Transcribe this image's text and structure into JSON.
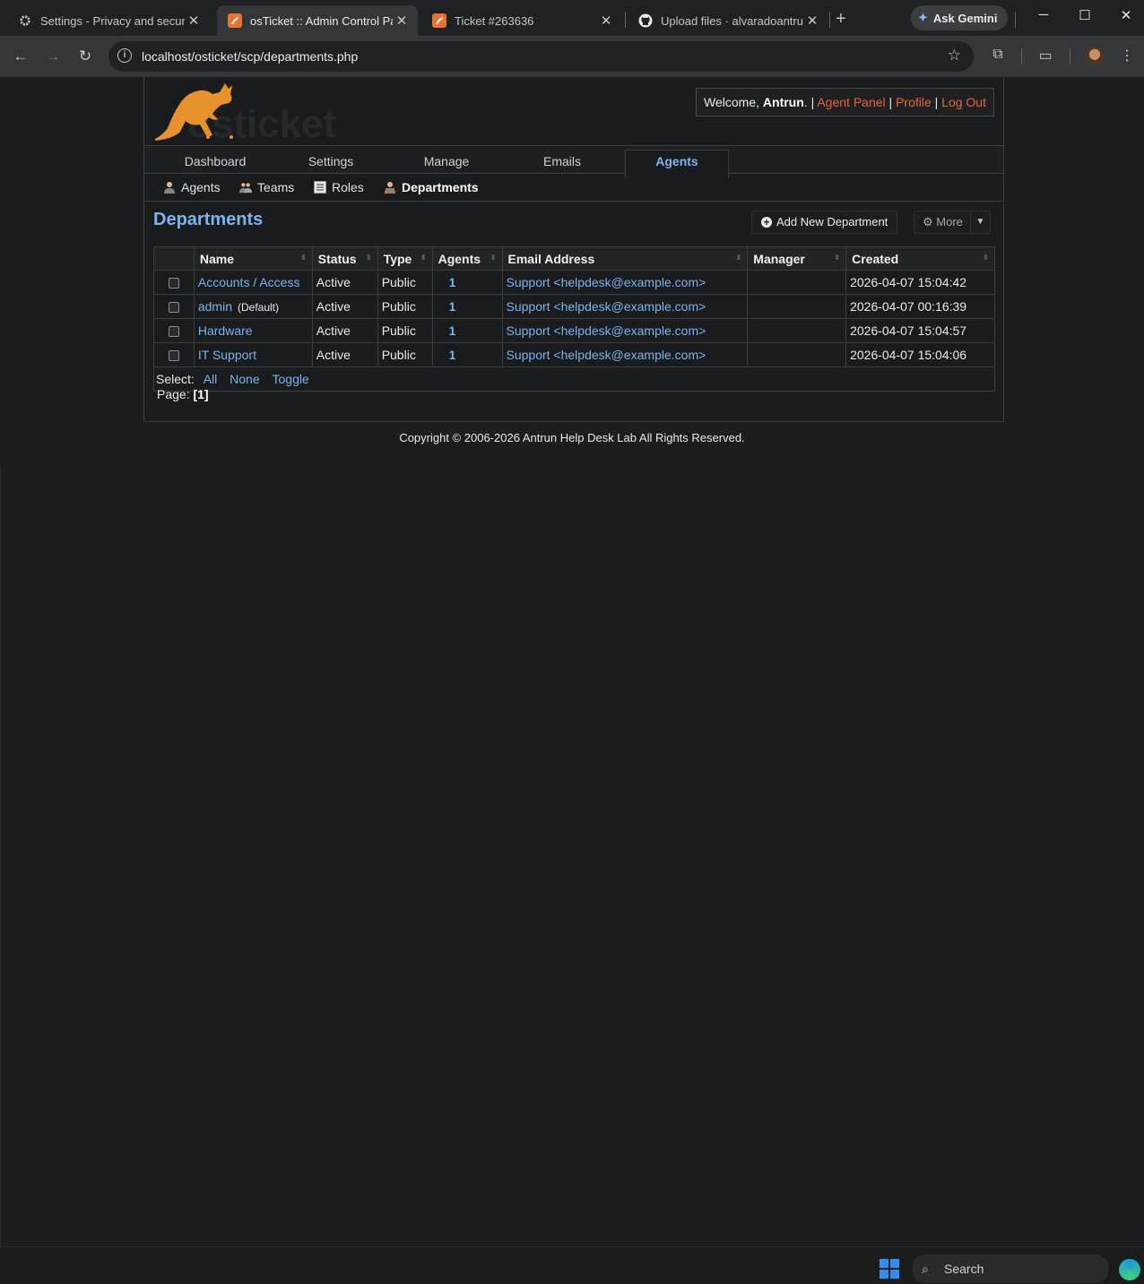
{
  "browser": {
    "tabs": [
      {
        "title": "Settings - Privacy and security",
        "icon": "gear-icon"
      },
      {
        "title": "osTicket :: Admin Control Panel",
        "icon": "osticket-icon"
      },
      {
        "title": "Ticket #263636",
        "icon": "osticket-icon"
      },
      {
        "title": "Upload files · alvaradoantrun/",
        "icon": "github-icon"
      }
    ],
    "ask_gemini": "Ask Gemini",
    "url": "localhost/osticket/scp/departments.php"
  },
  "header": {
    "welcome_prefix": "Welcome,",
    "user": "Antrun",
    "welcome_suffix": ". |",
    "links": [
      "Agent Panel",
      "Profile",
      "Log Out"
    ]
  },
  "nav": {
    "tabs": [
      "Dashboard",
      "Settings",
      "Manage",
      "Emails",
      "Agents"
    ],
    "active": "Agents"
  },
  "subnav": {
    "items": [
      "Agents",
      "Teams",
      "Roles",
      "Departments"
    ],
    "active": "Departments"
  },
  "page": {
    "title": "Departments",
    "add_button": "Add New Department",
    "more_button": "More"
  },
  "table": {
    "columns": [
      "Name",
      "Status",
      "Type",
      "Agents",
      "Email Address",
      "Manager",
      "Created"
    ],
    "rows": [
      {
        "name": "Accounts / Access",
        "default": "",
        "status": "Active",
        "type": "Public",
        "agents": "1",
        "email": "Support <helpdesk@example.com>",
        "manager": "",
        "created": "2026-04-07 15:04:42"
      },
      {
        "name": "admin",
        "default": "(Default)",
        "status": "Active",
        "type": "Public",
        "agents": "1",
        "email": "Support <helpdesk@example.com>",
        "manager": "",
        "created": "2026-04-07 00:16:39"
      },
      {
        "name": "Hardware",
        "default": "",
        "status": "Active",
        "type": "Public",
        "agents": "1",
        "email": "Support <helpdesk@example.com>",
        "manager": "",
        "created": "2026-04-07 15:04:57"
      },
      {
        "name": "IT Support",
        "default": "",
        "status": "Active",
        "type": "Public",
        "agents": "1",
        "email": "Support <helpdesk@example.com>",
        "manager": "",
        "created": "2026-04-07 15:04:06"
      }
    ],
    "select_label": "Select:",
    "select_links": [
      "All",
      "None",
      "Toggle"
    ]
  },
  "pager": {
    "label": "Page:",
    "current": "[1]"
  },
  "footer": {
    "copyright": "Copyright © 2006-2026 Antrun Help Desk Lab All Rights Reserved."
  },
  "taskbar": {
    "search_placeholder": "Search"
  },
  "colors": {
    "accent_blue": "#7cb3f0",
    "link_orange": "#e8643c",
    "logo_orange": "#e8922e"
  }
}
